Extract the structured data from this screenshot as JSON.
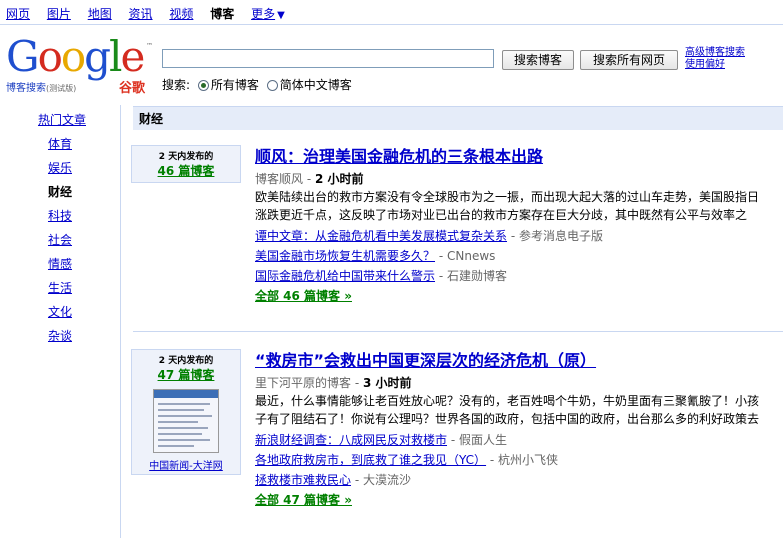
{
  "topnav": {
    "items": [
      "网页",
      "图片",
      "地图",
      "资讯",
      "视频"
    ],
    "current": "博客",
    "more": "更多",
    "more_arrow": "▼"
  },
  "logo": {
    "word": "Google",
    "subtitle": "博客搜索",
    "beta": "(测试版)",
    "cn": "谷歌"
  },
  "search": {
    "query": "",
    "btn_blog": "搜索博客",
    "btn_web": "搜索所有网页",
    "adv_search": "高级博客搜索",
    "prefs": "使用偏好",
    "scope_label": "搜索:",
    "scope_all": "所有博客",
    "scope_cn": "简体中文博客"
  },
  "sidebar": {
    "top": "热门文章",
    "items": [
      "体育",
      "娱乐",
      "财经",
      "科技",
      "社会",
      "情感",
      "生活",
      "文化",
      "杂谈"
    ],
    "current": "财经"
  },
  "category": "财经",
  "stories": [
    {
      "count_line1": "2 天内发布的",
      "count_line2": "46 篇博客",
      "title": "顺风：治理美国金融危机的三条根本出路",
      "source": "博客顺风",
      "time": "2 小时前",
      "snippet": "欧美陆续出台的救市方案没有令全球股市为之一振，而出现大起大落的过山车走势，美国股指日涨跌更近千点，这反映了市场对业已出台的救市方案存在巨大分歧，其中既然有公平与效率之",
      "related": [
        {
          "text": "谭中文章：从金融危机看中美发展模式复杂关系",
          "source": "参考消息电子版"
        },
        {
          "text": "美国金融市场恢复生机需要多久？",
          "source": "CNnews"
        },
        {
          "text": "国际金融危机给中国带来什么警示",
          "source": "石建勋博客"
        }
      ],
      "all": "全部 46 篇博客 »"
    },
    {
      "count_line1": "2 天内发布的",
      "count_line2": "47 篇博客",
      "thumb_caption": "中国新闻-大洋网",
      "title": "“救房市”会救出中国更深层次的经济危机（原）",
      "source": "里下河平原的博客",
      "time": "3 小时前",
      "snippet": "最近，什么事情能够让老百姓放心呢？没有的，老百姓喝个牛奶，牛奶里面有三聚氰胺了！小孩子有了阻结石了！你说有公理吗？世界各国的政府，包括中国的政府，出台那么多的利好政策去",
      "related": [
        {
          "text": "新浪财经调查：八成网民反对救楼市",
          "source": "假面人生"
        },
        {
          "text": "各地政府救房市，到底救了谁之我见（YC）",
          "source": "杭州小飞侠"
        },
        {
          "text": "拯救楼市难救民心",
          "source": "大漠流沙"
        }
      ],
      "all": "全部 47 篇博客 »"
    }
  ]
}
